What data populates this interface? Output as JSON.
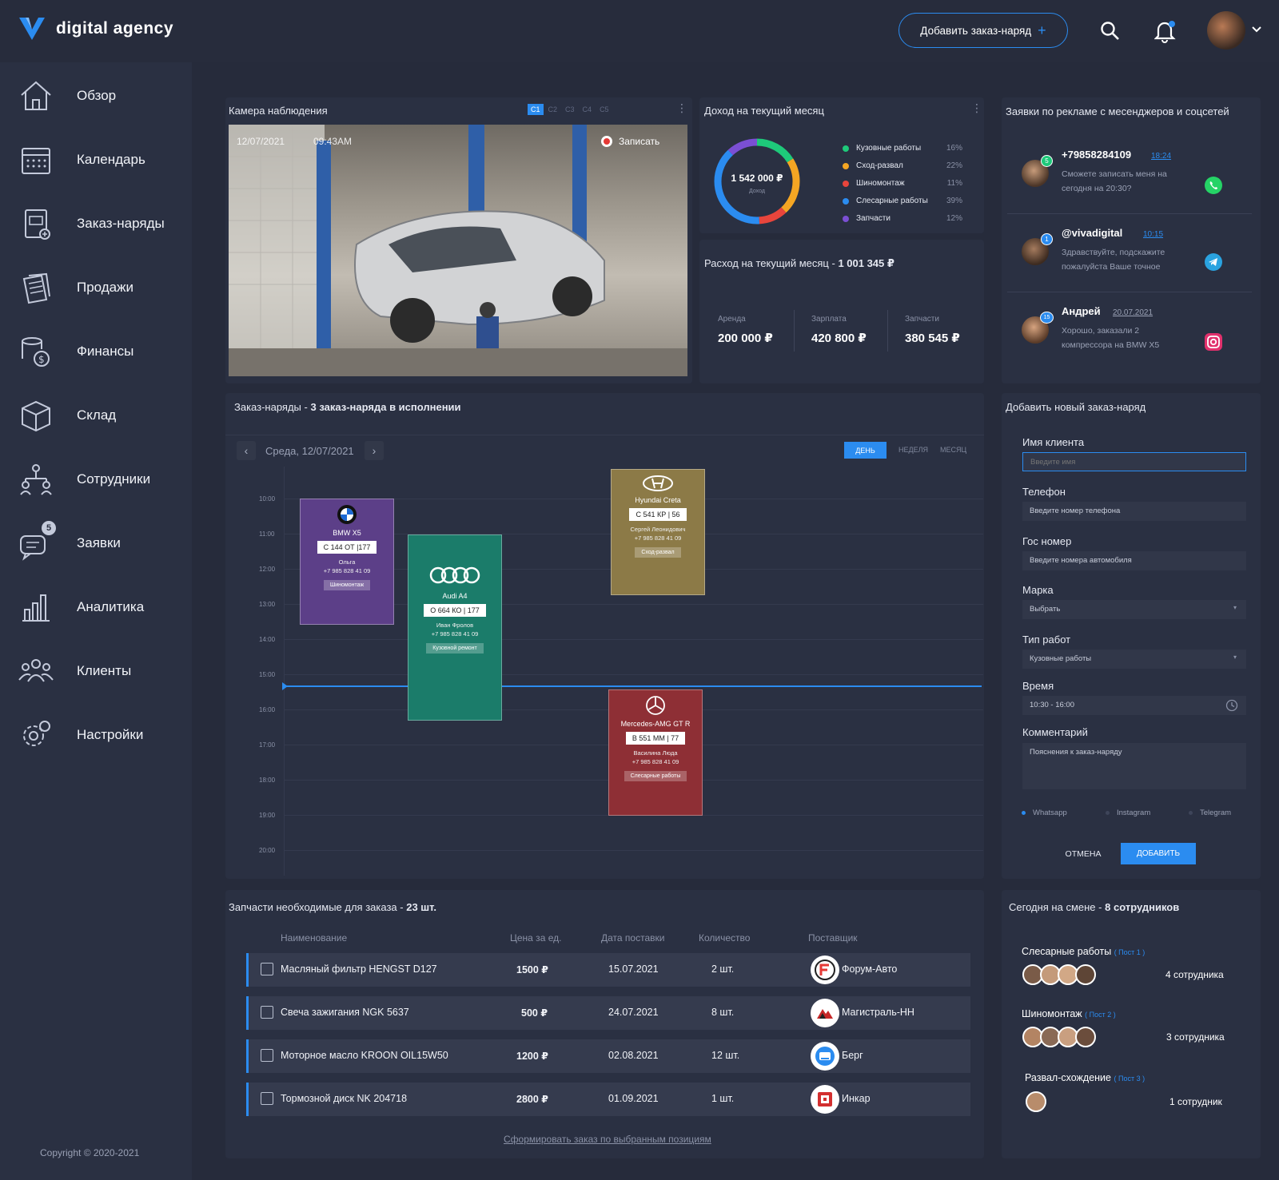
{
  "brand": {
    "name": "digital agency"
  },
  "header": {
    "add_button": "Добавить заказ-наряд",
    "add_plus": "+"
  },
  "sidebar": {
    "items": [
      {
        "label": "Обзор"
      },
      {
        "label": "Календарь"
      },
      {
        "label": "Заказ-наряды"
      },
      {
        "label": "Продажи"
      },
      {
        "label": "Финансы"
      },
      {
        "label": "Склад"
      },
      {
        "label": "Сотрудники"
      },
      {
        "label": "Заявки",
        "badge": "5"
      },
      {
        "label": "Аналитика"
      },
      {
        "label": "Клиенты"
      },
      {
        "label": "Настройки"
      }
    ],
    "copyright": "Copyright © 2020-2021"
  },
  "camera": {
    "title": "Камера наблюдения",
    "tabs": [
      "C1",
      "C2",
      "C3",
      "C4",
      "C5"
    ],
    "date": "12/07/2021",
    "time": "09:43AM",
    "record": "Записать"
  },
  "income": {
    "title": "Доход на текущий месяц",
    "total": "1 542 000 ₽",
    "total_label": "Доход",
    "legend": [
      {
        "name": "Кузовные работы",
        "pct": "16%",
        "value": 16,
        "color": "#1ec97a"
      },
      {
        "name": "Сход-развал",
        "pct": "22%",
        "value": 22,
        "color": "#f5a623"
      },
      {
        "name": "Шиномонтаж",
        "pct": "11%",
        "value": 11,
        "color": "#e8453c"
      },
      {
        "name": "Слесарные работы",
        "pct": "39%",
        "value": 39,
        "color": "#2b8cf0"
      },
      {
        "name": "Запчасти",
        "pct": "12%",
        "value": 12,
        "color": "#7b4fd4"
      }
    ]
  },
  "expense": {
    "title": "Расход на текущий месяц",
    "sep": "-",
    "total": "1 001 345 ₽",
    "items": [
      {
        "label": "Аренда",
        "value": "200 000 ₽"
      },
      {
        "label": "Зарплата",
        "value": "420 800 ₽"
      },
      {
        "label": "Запчасти",
        "value": "380 545 ₽"
      }
    ]
  },
  "messages": {
    "title": "Заявки по рекламе с месенджеров и соцсетей",
    "items": [
      {
        "name": "+79858284109",
        "time": "18:24",
        "text1": "Сможете записать меня на",
        "text2": "сегодня на 20:30?",
        "badge": "5",
        "channel": "whatsapp-icon"
      },
      {
        "name": "@vivadigital",
        "time": "10:15",
        "text1": "Здравствуйте, подскажите",
        "text2": "пожалуйста Ваше точное",
        "badge": "1",
        "channel": "telegram-icon"
      },
      {
        "name": "Андрей",
        "time": "20.07.2021",
        "text1": "Хорошо, заказали  2",
        "text2": "компрессора на BMW X5",
        "badge": "15",
        "channel": "instagram-icon"
      }
    ]
  },
  "orders": {
    "title": "Заказ-наряды",
    "sep": "-",
    "subtitle": "3 заказ-наряда в исполнении",
    "date": "Среда, 12/07/2021",
    "views": [
      "ДЕНЬ",
      "НЕДЕЛЯ",
      "МЕСЯЦ"
    ],
    "hours": [
      "10:00",
      "11:00",
      "12:00",
      "13:00",
      "14:00",
      "15:00",
      "16:00",
      "17:00",
      "18:00",
      "19:00",
      "20:00"
    ],
    "events": [
      {
        "car": "BMW X5",
        "plate": "С 144 ОТ  |177",
        "person": "Ольга",
        "phone": "+7 985 828 41 09",
        "work": "Шиномонтаж",
        "logo": "bmw-logo-icon"
      },
      {
        "car": "Audi A4",
        "plate": "О 664 КО  | 177",
        "person": "Иван Фролов",
        "phone": "+7 985 828 41 09",
        "work": "Кузовной ремонт",
        "logo": "audi-logo-icon"
      },
      {
        "car": "Hyundai Creta",
        "plate": "С 541 КР  |  56",
        "person": "Сергей Леонидович",
        "phone": "+7 985 828 41 09",
        "work": "Сход-развал",
        "logo": "hyundai-logo-icon"
      },
      {
        "car": "Mercedes-AMG GT R",
        "plate": "В 551 ММ |  77",
        "person": "Василина Люда",
        "phone": "+7 985 828 41 09",
        "work": "Слесарные работы",
        "logo": "mercedes-logo-icon"
      }
    ]
  },
  "form": {
    "title": "Добавить новый заказ-наряд",
    "fields": [
      {
        "label": "Имя клиента",
        "placeholder": "Введите имя"
      },
      {
        "label": "Телефон",
        "placeholder": "Введите номер телефона"
      },
      {
        "label": "Гос номер",
        "placeholder": "Введите номера автомобиля"
      },
      {
        "label": "Марка",
        "value": "Выбрать"
      },
      {
        "label": "Тип работ",
        "value": "Кузовные  работы"
      },
      {
        "label": "Время",
        "value": "10:30 - 16:00"
      },
      {
        "label": "Комментарий",
        "placeholder": "Пояснения к заказ-наряду"
      }
    ],
    "channels": [
      "Whatsapp",
      "Instagram",
      "Telegram"
    ],
    "cancel": "ОТМЕНА",
    "submit": "ДОБАВИТЬ"
  },
  "parts": {
    "title": "Запчасти необходимые для заказа",
    "sep": "-",
    "count": "23 шт.",
    "columns": [
      "Наименование",
      "Цена за ед.",
      "Дата поставки",
      "Количество",
      "Поставщик"
    ],
    "rows": [
      {
        "name": "Масляный фильтр HENGST D127",
        "price": "1500 ₽",
        "date": "15.07.2021",
        "qty": "2 шт.",
        "supplier": "Форум-Авто"
      },
      {
        "name": "Свеча зажигания NGK 5637",
        "price": "500 ₽",
        "date": "24.07.2021",
        "qty": "8 шт.",
        "supplier": "Магистраль-НН"
      },
      {
        "name": "Моторное масло KROON OIL15W50",
        "price": "1200 ₽",
        "date": "02.08.2021",
        "qty": "12 шт.",
        "supplier": "Берг"
      },
      {
        "name": "Тормозной диск NK 204718",
        "price": "2800 ₽",
        "date": "01.09.2021",
        "qty": "1 шт.",
        "supplier": "Инкар"
      }
    ],
    "order_link": "Сформировать заказ по выбранным позициям"
  },
  "shift": {
    "title": "Сегодня на смене",
    "sep": "-",
    "count": "8 сотрудников",
    "groups": [
      {
        "name": "Слесарные работы",
        "post": "( Пост 1 )",
        "count": "4 сотрудника",
        "avatars": 4
      },
      {
        "name": "Шиномонтаж",
        "post": "( Пост 2 )",
        "count": "3 сотрудника",
        "avatars": 4
      },
      {
        "name": "Развал-схождение",
        "post": "( Пост 3 )",
        "count": "1 сотрудник",
        "avatars": 1
      }
    ]
  }
}
